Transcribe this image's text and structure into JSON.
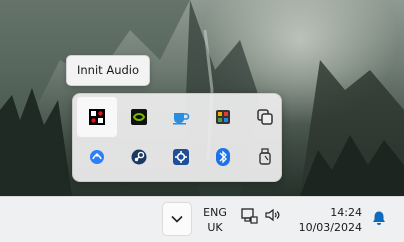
{
  "tooltip": {
    "text": "Innit Audio"
  },
  "tray": {
    "icons": [
      {
        "name": "innit-audio-icon"
      },
      {
        "name": "nvidia-icon"
      },
      {
        "name": "cup-icon"
      },
      {
        "name": "app-color-icon"
      },
      {
        "name": "multi-window-icon"
      },
      {
        "name": "globe-network-icon"
      },
      {
        "name": "steam-icon"
      },
      {
        "name": "gear-app-icon"
      },
      {
        "name": "bluetooth-icon"
      },
      {
        "name": "usb-drive-icon"
      }
    ]
  },
  "taskbar": {
    "language": {
      "line1": "ENG",
      "line2": "UK"
    },
    "clock": {
      "time": "14:24",
      "date": "10/03/2024"
    }
  },
  "colors": {
    "accent": "#0f6cbd",
    "steam": "#1b3a63",
    "nvidia": "#76b900"
  }
}
